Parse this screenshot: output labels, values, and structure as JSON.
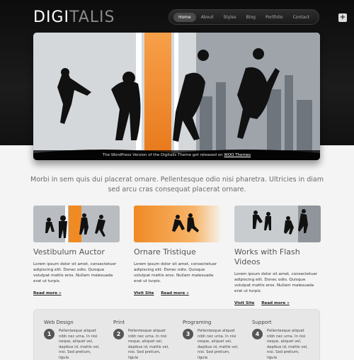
{
  "logo": {
    "part1": "DIGI",
    "part2": "TALIS"
  },
  "nav": {
    "items": [
      "Home",
      "About",
      "Styles",
      "Blog",
      "Portfolio",
      "Contact"
    ]
  },
  "plus_label": "+",
  "hero": {
    "caption_prefix": "The WordPress Version of the Digitalis Theme got released on ",
    "caption_link": "WOO Themes"
  },
  "tagline": "Morbi in sem quis dui placerat ornare. Pellentesque odio nisi pharetra. Ultricies in diam sed arcu cras consequat placerat ornare.",
  "features": [
    {
      "title": "Vestibulum Auctor",
      "text": "Lorem ipsum dolor sit amet, consectetuer adipiscing elit. Donec odio. Quisque volutpat mattis eros. Nullam malesuada erat ut turpis.",
      "link1": "Read more »",
      "link2": ""
    },
    {
      "title": "Ornare Tristique",
      "text": "Lorem ipsum dolor sit amet, consectetuer adipiscing elit. Donec odio. Quisque volutpat mattis eros. Nullam malesuada erat ut turpis.",
      "link1": "Visit Site",
      "link2": "Read more »"
    },
    {
      "title": "Works with Flash Videos",
      "text": "Lorem ipsum dolor sit amet, consectetuer adipiscing elit. Donec odio. Quisque volutpat mattis eros. Nullam malesuada erat ut turpis.",
      "link1": "Visit Site",
      "link2": "Read more »"
    }
  ],
  "services": [
    {
      "title": "Web Design",
      "num": "1",
      "text": "Pellentesque aliquet nibh nec urna. In nisi neque, aliquet vel, dapibus id, mattis vel, nisi. Sed pretium, ligula"
    },
    {
      "title": "Print",
      "num": "2",
      "text": "Pellentesque aliquet nibh nec urna. In nisi neque, aliquet vel, dapibus id, mattis vel, nisi. Sed pretium, ligula"
    },
    {
      "title": "Programing",
      "num": "3",
      "text": "Pellentesque aliquet nibh nec urna. In nisi neque, aliquet vel, dapibus id, mattis vel, nisi. Sed pretium, ligula"
    },
    {
      "title": "Support",
      "num": "4",
      "text": "Pellentesque aliquet nibh nec urna. In nisi neque, aliquet vel, dapibus id, mattis vel, nisi. Sed pretium, ligula"
    }
  ],
  "colors": {
    "accent": "#f08a24",
    "dark": "#111111"
  }
}
